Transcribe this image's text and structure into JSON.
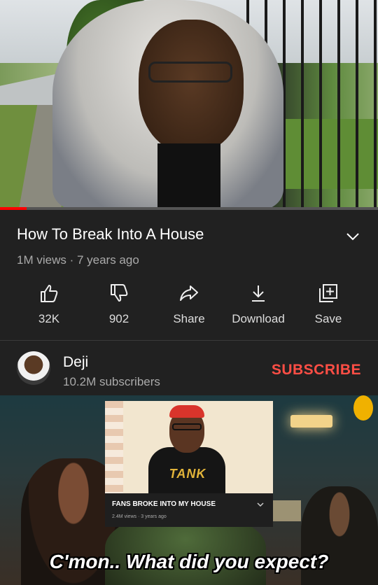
{
  "video": {
    "progress_fraction": 0.07
  },
  "info": {
    "title": "How To Break Into A House",
    "meta": "1M views · 7 years ago"
  },
  "actions": [
    {
      "label": "32K",
      "icon": "thumbs-up-icon"
    },
    {
      "label": "902",
      "icon": "thumbs-down-icon"
    },
    {
      "label": "Share",
      "icon": "share-icon"
    },
    {
      "label": "Download",
      "icon": "download-icon"
    },
    {
      "label": "Save",
      "icon": "save-playlist-icon"
    }
  ],
  "channel": {
    "name": "Deji",
    "subscribers": "10.2M subscribers",
    "subscribe_label": "SUBSCRIBE"
  },
  "meme": {
    "card_title": "FANS BROKE INTO MY HOUSE",
    "card_meta": "2.4M views · 3 years ago",
    "thumb_logo": "TANK",
    "caption": "C'mon.. What did you expect?"
  },
  "colors": {
    "background": "#212121",
    "accent_red": "#ff4e45",
    "progress_red": "#ff0000",
    "secondary_text": "#aaaaaa"
  }
}
